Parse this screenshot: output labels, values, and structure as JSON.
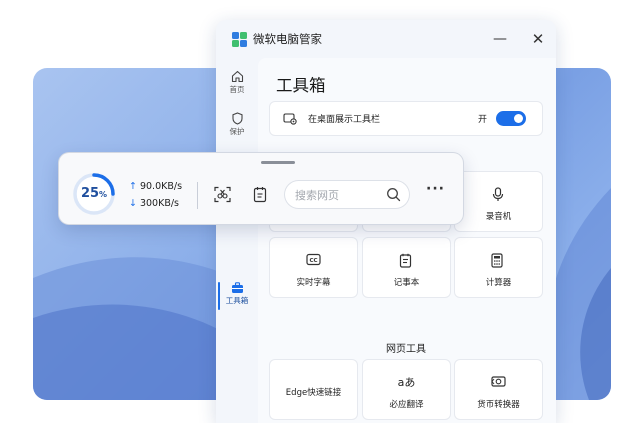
{
  "window": {
    "title": "微软电脑管家",
    "min_glyph": "—",
    "close_glyph": "✕"
  },
  "sidebar": {
    "items": [
      {
        "label": "首页",
        "icon": "home-icon"
      },
      {
        "label": "保护",
        "icon": "shield-icon"
      },
      {
        "label": "工具箱",
        "icon": "toolbox-icon",
        "active": true
      }
    ]
  },
  "main": {
    "title": "工具箱",
    "desktop_toolbar": {
      "label": "在桌面展示工具栏",
      "state": "开",
      "on": true
    },
    "tiles_row1": [
      {
        "label": "录音机",
        "icon": "microphone-icon"
      }
    ],
    "tiles_row2": [
      {
        "label": "实时字幕",
        "icon": "captions-icon"
      },
      {
        "label": "记事本",
        "icon": "notepad-icon"
      },
      {
        "label": "计算器",
        "icon": "calculator-icon"
      }
    ],
    "web_tools_title": "网页工具",
    "tiles_row3": [
      {
        "label": "Edge快速链接",
        "icon": ""
      },
      {
        "label": "必应翻译",
        "icon": "translate-icon",
        "glyph": "aあ"
      },
      {
        "label": "货币转换器",
        "icon": "currency-icon"
      }
    ]
  },
  "floatbar": {
    "usage_value": "25",
    "usage_unit": "%",
    "usage_fraction": 0.25,
    "upload_speed": "90.0KB/s",
    "download_speed": "300KB/s",
    "search_placeholder": "搜索网页",
    "more_glyph": "···"
  },
  "colors": {
    "accent": "#1c6ee8",
    "gauge_track": "#dbe6f7"
  }
}
